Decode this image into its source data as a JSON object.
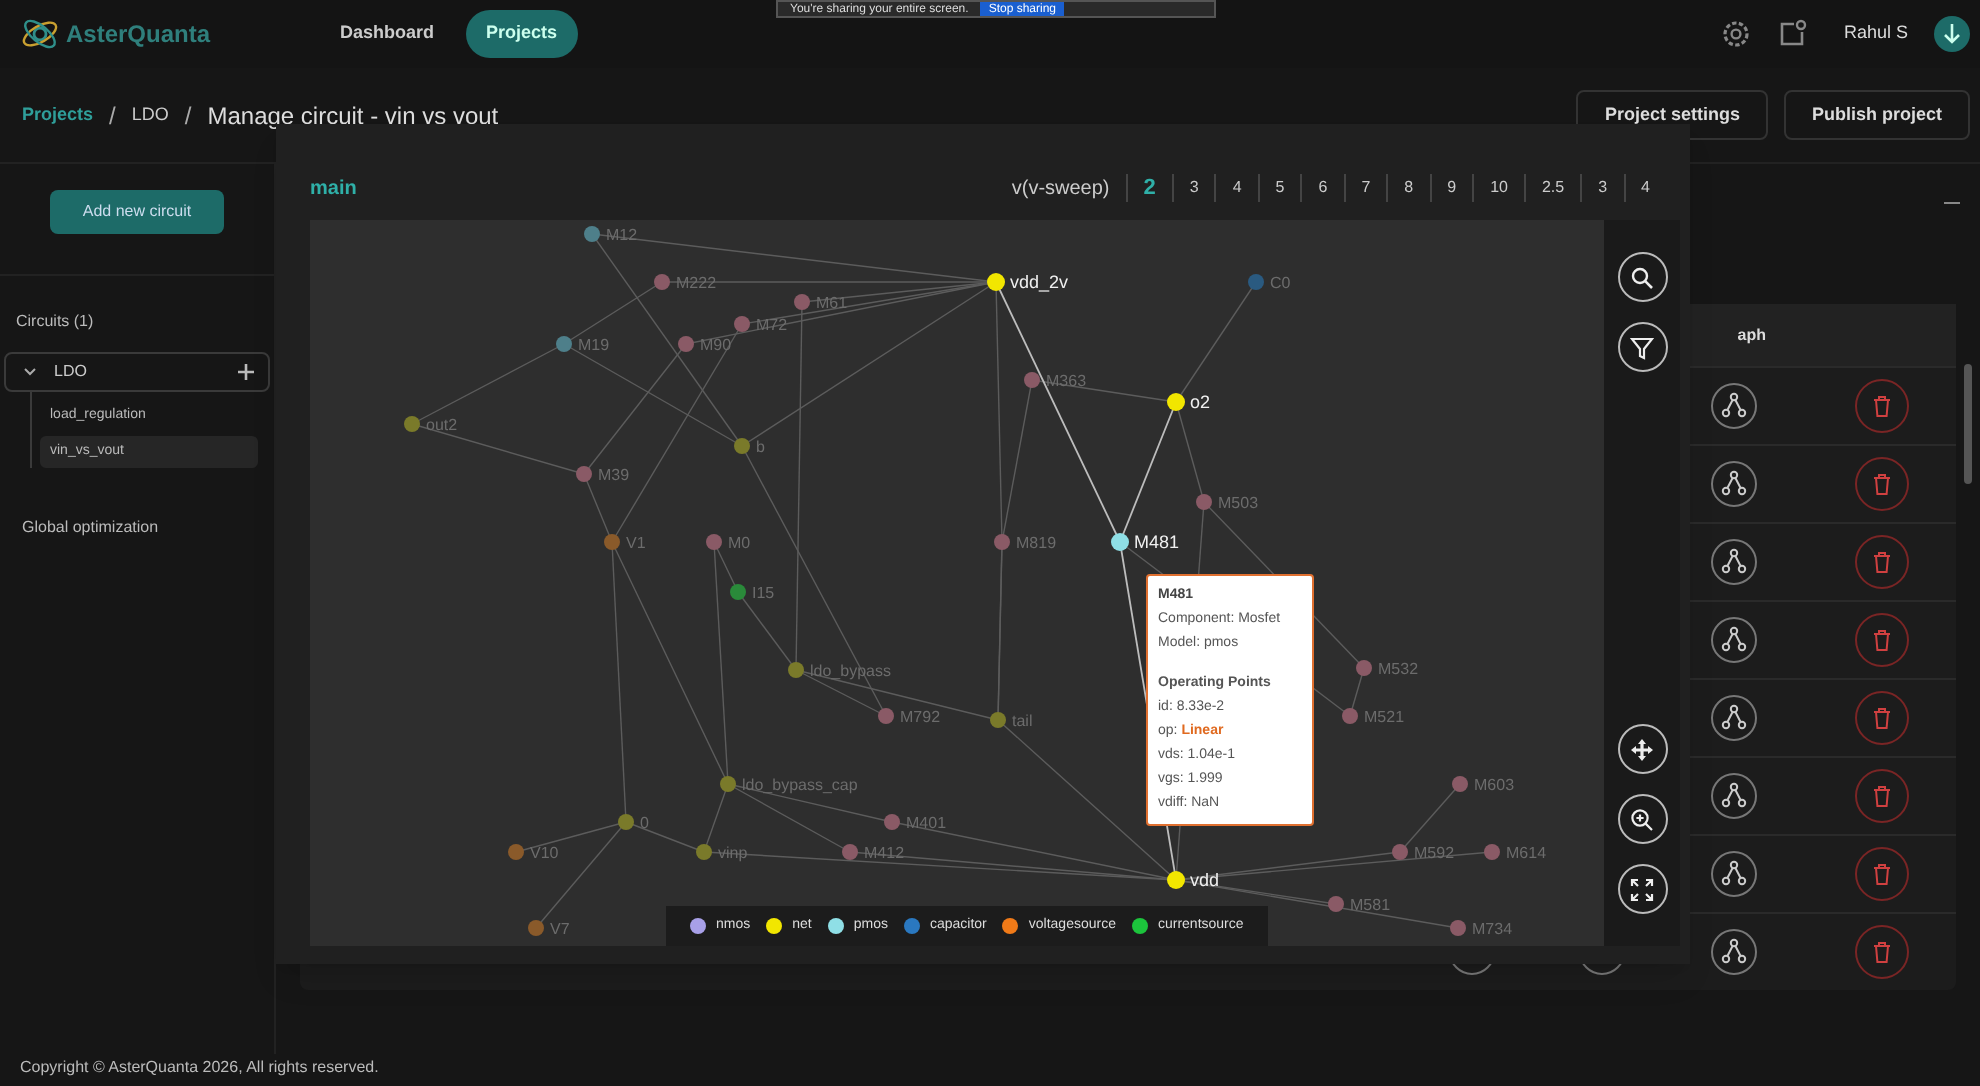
{
  "app": {
    "name": "AsterQuanta",
    "user": "Rahul S"
  },
  "nav": [
    {
      "label": "Dashboard",
      "selected": false
    },
    {
      "label": "Projects",
      "selected": true
    }
  ],
  "share_banner": {
    "text": "You're sharing your entire screen.",
    "button": "Stop sharing"
  },
  "breadcrumb": [
    {
      "label": "Projects",
      "kind": "link"
    },
    {
      "label": "LDO",
      "kind": "link",
      "separator": "/"
    },
    {
      "label": "Manage circuit - vin vs vout",
      "kind": "current",
      "separator": "/"
    }
  ],
  "actions": [
    "Project settings",
    "Publish project"
  ],
  "sidebar": {
    "add_button": "Add new circuit",
    "circuits_title": "Circuits (1)",
    "circuits": [
      {
        "label": "LDO",
        "expanded": true,
        "children": [
          {
            "label": "load_regulation",
            "selected": false
          },
          {
            "label": "vin_vs_vout",
            "selected": true
          }
        ]
      }
    ],
    "footer_item": "Global optimization"
  },
  "table": {
    "header": "aph"
  },
  "modal": {
    "title": "main",
    "sweep": {
      "label": "v(v-sweep)",
      "steps": [
        {
          "label": "2",
          "selected": true
        },
        {
          "label": "3",
          "selected": false
        },
        {
          "label": "4",
          "selected": false
        },
        {
          "label": "5",
          "selected": false
        },
        {
          "label": "6",
          "selected": false
        },
        {
          "label": "7",
          "selected": false
        },
        {
          "label": "8",
          "selected": false
        },
        {
          "label": "9",
          "selected": false
        },
        {
          "label": "10",
          "selected": false
        },
        {
          "label": "2.5",
          "selected": false
        },
        {
          "label": "3",
          "selected": false
        },
        {
          "label": "4",
          "selected": false
        }
      ]
    },
    "graph": {
      "nodes": [
        {
          "label": "M12",
          "color": "#4e7f8a",
          "highlighted": false
        },
        {
          "label": "M222",
          "color": "#8a5a66",
          "highlighted": false
        },
        {
          "label": "vdd_2v",
          "color": "#f2e600",
          "highlighted": true
        },
        {
          "label": "C0",
          "color": "#2a5a80",
          "highlighted": false
        },
        {
          "label": "M61",
          "color": "#8a5a66",
          "highlighted": false
        },
        {
          "label": "M72",
          "color": "#8a5a66",
          "highlighted": false
        },
        {
          "label": "M19",
          "color": "#4e7f8a",
          "highlighted": false
        },
        {
          "label": "M90",
          "color": "#8a5a66",
          "highlighted": false
        },
        {
          "label": "M363",
          "color": "#8a5a66",
          "highlighted": false
        },
        {
          "label": "o2",
          "color": "#f2e600",
          "highlighted": true
        },
        {
          "label": "out2",
          "color": "#7a7a2a",
          "highlighted": false
        },
        {
          "label": "b",
          "color": "#7a7a2a",
          "highlighted": false
        },
        {
          "label": "M39",
          "color": "#8a5a66",
          "highlighted": false
        },
        {
          "label": "M503",
          "color": "#8a5a66",
          "highlighted": false
        },
        {
          "label": "V1",
          "color": "#8a5a2a",
          "highlighted": false
        },
        {
          "label": "M0",
          "color": "#8a5a66",
          "highlighted": false
        },
        {
          "label": "M819",
          "color": "#8a5a66",
          "highlighted": false
        },
        {
          "label": "M481",
          "color": "#8fdfe6",
          "highlighted": true
        },
        {
          "label": "I15",
          "color": "#2a8a3a",
          "highlighted": false
        },
        {
          "label": "ldo_bypass",
          "color": "#7a7a2a",
          "highlighted": false
        },
        {
          "label": "M532",
          "color": "#8a5a66",
          "highlighted": false
        },
        {
          "label": "M792",
          "color": "#8a5a66",
          "highlighted": false
        },
        {
          "label": "tail",
          "color": "#7a7a2a",
          "highlighted": false
        },
        {
          "label": "M521",
          "color": "#8a5a66",
          "highlighted": false
        },
        {
          "label": "ldo_bypass_cap",
          "color": "#7a7a2a",
          "highlighted": false
        },
        {
          "label": "M603",
          "color": "#8a5a66",
          "highlighted": false
        },
        {
          "label": "0",
          "color": "#7a7a2a",
          "highlighted": false
        },
        {
          "label": "M401",
          "color": "#8a5a66",
          "highlighted": false
        },
        {
          "label": "V10",
          "color": "#8a5a2a",
          "highlighted": false
        },
        {
          "label": "vinp",
          "color": "#7a7a2a",
          "highlighted": false
        },
        {
          "label": "M412",
          "color": "#8a5a66",
          "highlighted": false
        },
        {
          "label": "M592",
          "color": "#8a5a66",
          "highlighted": false
        },
        {
          "label": "M614",
          "color": "#8a5a66",
          "highlighted": false
        },
        {
          "label": "vdd",
          "color": "#f2e600",
          "highlighted": true
        },
        {
          "label": "M581",
          "color": "#8a5a66",
          "highlighted": false
        },
        {
          "label": "V7",
          "color": "#8a5a2a",
          "highlighted": false
        },
        {
          "label": "M734",
          "color": "#8a5a66",
          "highlighted": false
        }
      ],
      "tooltip": [
        {
          "kind": "title",
          "text": "M481"
        },
        {
          "kind": "text",
          "text": "Component: Mosfet"
        },
        {
          "kind": "text",
          "text": "Model: pmos"
        },
        {
          "kind": "heading",
          "text": "Operating Points"
        },
        {
          "kind": "text",
          "text": "id: 8.33e-2"
        },
        {
          "kind": "status",
          "text": "op:",
          "value": "Linear"
        },
        {
          "kind": "text",
          "text": "vds: 1.04e-1"
        },
        {
          "kind": "text",
          "text": "vgs: 1.999"
        },
        {
          "kind": "text",
          "text": "vdiff: NaN"
        }
      ],
      "legend": [
        {
          "label": "nmos",
          "color": "#a8a0e8"
        },
        {
          "label": "net",
          "color": "#f2e600"
        },
        {
          "label": "pmos",
          "color": "#8fdfe6"
        },
        {
          "label": "capacitor",
          "color": "#2a78c0"
        },
        {
          "label": "voltagesource",
          "color": "#f07a18"
        },
        {
          "label": "currentsource",
          "color": "#1cc43c"
        }
      ]
    }
  },
  "footer": "Copyright © AsterQuanta 2026, All rights reserved."
}
